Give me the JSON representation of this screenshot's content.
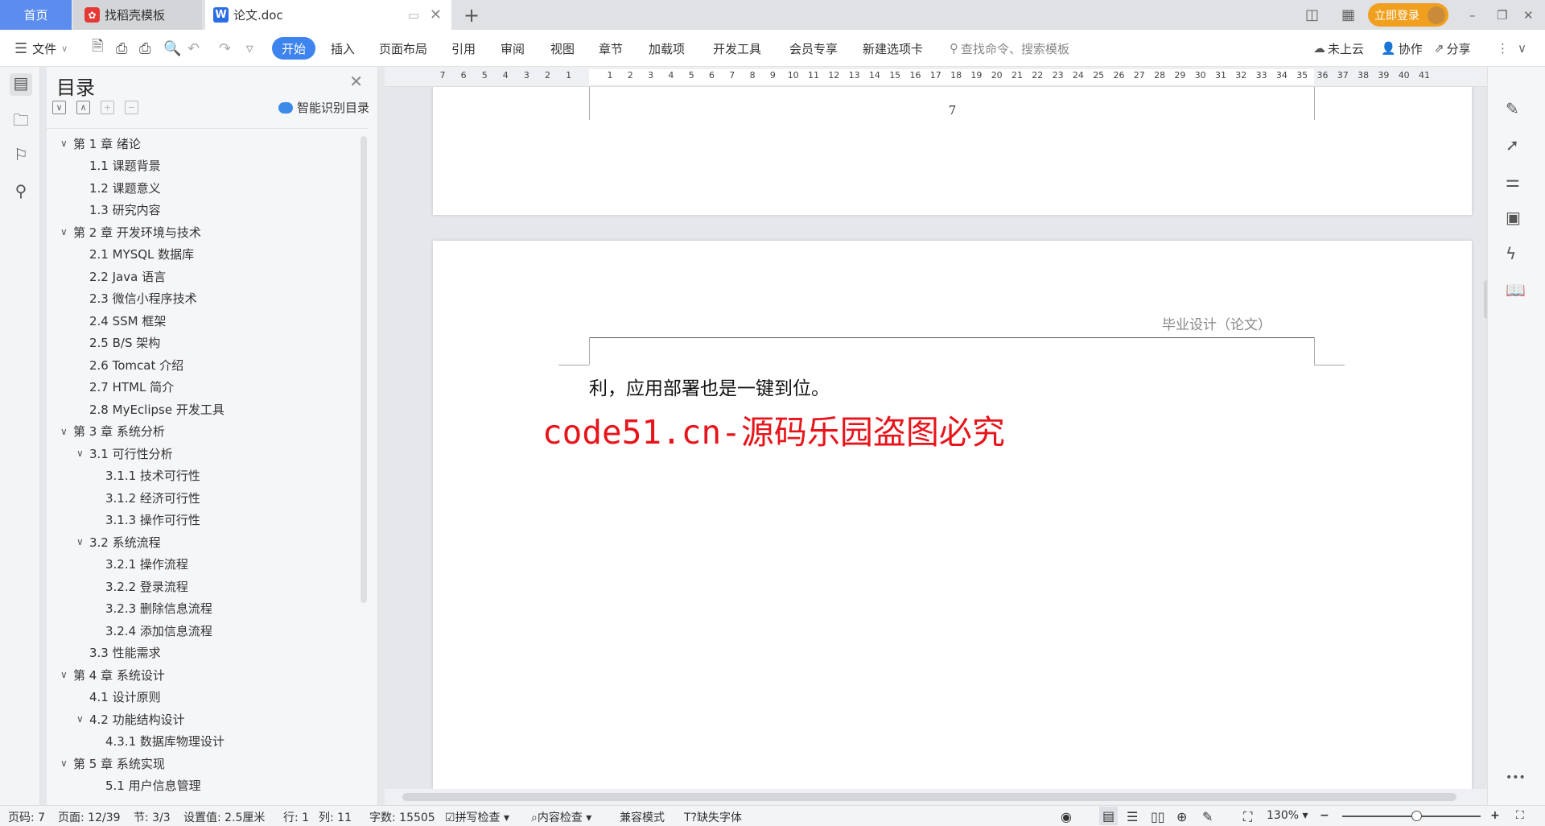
{
  "tabs": {
    "home": "首页",
    "template": "找稻壳模板",
    "doc": "论文.doc",
    "new_tab": "+"
  },
  "window": {
    "login": "立即登录",
    "minimize": "–",
    "restore": "❐",
    "close": "✕"
  },
  "toolbar": {
    "file": "文件",
    "menus": [
      "开始",
      "插入",
      "页面布局",
      "引用",
      "审阅",
      "视图",
      "章节",
      "加载项",
      "开发工具",
      "会员专享",
      "新建选项卡"
    ],
    "search_placeholder": "查找命令、搜索模板",
    "cloud": "未上云",
    "collab": "协作",
    "share": "分享"
  },
  "toc": {
    "title": "目录",
    "smart": "智能识别目录",
    "items": [
      {
        "label": "第 1 章  绪论",
        "level": 1,
        "chev": true
      },
      {
        "label": "1.1  课题背景",
        "level": 2
      },
      {
        "label": "1.2  课题意义",
        "level": 2
      },
      {
        "label": "1.3  研究内容",
        "level": 2
      },
      {
        "label": "第 2 章  开发环境与技术",
        "level": 1,
        "chev": true
      },
      {
        "label": "2.1 MYSQL 数据库",
        "level": 2
      },
      {
        "label": "2.2 Java 语言",
        "level": 2
      },
      {
        "label": "2.3  微信小程序技术",
        "level": 2
      },
      {
        "label": "2.4 SSM 框架",
        "level": 2
      },
      {
        "label": "2.5 B/S 架构",
        "level": 2
      },
      {
        "label": "2.6 Tomcat  介绍",
        "level": 2
      },
      {
        "label": "2.7 HTML 简介",
        "level": 2
      },
      {
        "label": "2.8 MyEclipse 开发工具",
        "level": 2
      },
      {
        "label": "第 3 章  系统分析",
        "level": 1,
        "chev": true
      },
      {
        "label": "3.1  可行性分析",
        "level": 2,
        "chev": true
      },
      {
        "label": "3.1.1  技术可行性",
        "level": 3
      },
      {
        "label": "3.1.2  经济可行性",
        "level": 3
      },
      {
        "label": "3.1.3  操作可行性",
        "level": 3
      },
      {
        "label": "3.2  系统流程",
        "level": 2,
        "chev": true
      },
      {
        "label": "3.2.1  操作流程",
        "level": 3
      },
      {
        "label": "3.2.2  登录流程",
        "level": 3
      },
      {
        "label": "3.2.3  删除信息流程",
        "level": 3
      },
      {
        "label": "3.2.4  添加信息流程",
        "level": 3
      },
      {
        "label": "3.3  性能需求",
        "level": 2
      },
      {
        "label": "第 4 章  系统设计",
        "level": 1,
        "chev": true
      },
      {
        "label": "4.1  设计原则",
        "level": 2
      },
      {
        "label": "4.2  功能结构设计",
        "level": 2,
        "chev": true
      },
      {
        "label": "4.3.1  数据库物理设计",
        "level": 3
      },
      {
        "label": "第 5 章  系统实现",
        "level": 1,
        "chev": true
      },
      {
        "label": "5.1 用户信息管理",
        "level": 3
      }
    ]
  },
  "ruler": {
    "left": [
      "7",
      "6",
      "5",
      "4",
      "3",
      "2",
      "1"
    ],
    "right_count": 41
  },
  "document": {
    "page_number": "7",
    "header": "毕业设计（论文）",
    "body": "利，应用部署也是一键到位。",
    "watermark": "code51.cn-源码乐园盗图必究",
    "watermark_color": "#e8141b"
  },
  "status": {
    "page": "页码: 7",
    "pages": "页面: 12/39",
    "section": "节: 3/3",
    "setting": "设置值: 2.5厘米",
    "line": "行: 1",
    "col": "列: 11",
    "words": "字数: 15505",
    "spell": "拼写检查",
    "content": "内容检查",
    "compat": "兼容模式",
    "font": "缺失字体",
    "zoom": "130%"
  },
  "colors": {
    "accent": "#3d84ee",
    "login": "#f0a01e"
  }
}
